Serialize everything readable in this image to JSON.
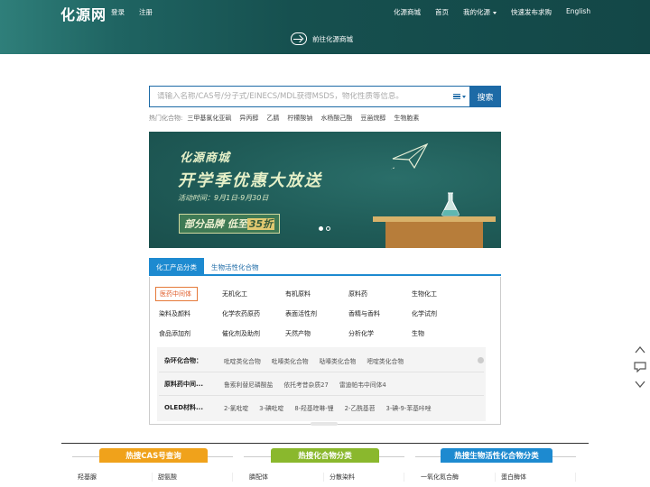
{
  "header": {
    "logo": "化源网",
    "login": "登录",
    "register": "注册",
    "nav": [
      "化源商城",
      "首页",
      "我的化源",
      "快速发布求购",
      "English"
    ],
    "to_mall": "前往化源商城"
  },
  "search": {
    "placeholder": "请输入名称/CAS号/分子式/EINECS/MDL获得MSDS，物化性质等信息。",
    "button": "搜索"
  },
  "hot": {
    "label": "热门化合物:",
    "items": [
      "三甲基氯化亚砜",
      "异丙醇",
      "乙腈",
      "柠檬酸钠",
      "水杨酸己酯",
      "豆甾烷醇",
      "生物胞素"
    ]
  },
  "banner": {
    "title1": "化源商城",
    "title2": "开学季优惠大放送",
    "date": "活动时间：9月1日-9月30日",
    "tag_prefix": "部分品牌 低至",
    "tag_highlight": "35折"
  },
  "tabs": [
    "化工产品分类",
    "生物活性化合物"
  ],
  "categories": [
    [
      "医药中间体",
      "无机化工",
      "有机原料",
      "原料药",
      "生物化工"
    ],
    [
      "染料及颜料",
      "化学农药原药",
      "表面活性剂",
      "香精与香料",
      "化学试剂"
    ],
    [
      "食品添加剂",
      "催化剂及助剂",
      "天然产物",
      "分析化学",
      "生物"
    ]
  ],
  "sub_categories": [
    {
      "title": "杂环化合物：",
      "items": [
        "吡啶类化合物",
        "吡嗪类化合物",
        "哒嗪类化合物",
        "嘧啶类化合物"
      ]
    },
    {
      "title": "原料药中间...",
      "items": [
        "鲁索利替尼磷酸盐",
        "依托考昔杂质27",
        "雷迪帕韦中间体4"
      ]
    },
    {
      "title": "OLED材料...",
      "items": [
        "2-氯吡啶",
        "3-碘吡啶",
        "8-羟基喹啉-锂",
        "2-乙酰基苕",
        "3-碘-9-苯基咔唑"
      ]
    }
  ],
  "bottom": [
    {
      "title": "热搜CAS号查询",
      "color": "#f0a21b",
      "items": [
        "羟基脲",
        "甜氨酸"
      ]
    },
    {
      "title": "热搜化合物分类",
      "color": "#8ab82d",
      "items": [
        "膦配体",
        "分散染料"
      ]
    },
    {
      "title": "热搜生物活性化合物分类",
      "color": "#1d8ad0",
      "items": [
        "一氧化氮合酶",
        "蛋白酶体"
      ]
    }
  ]
}
